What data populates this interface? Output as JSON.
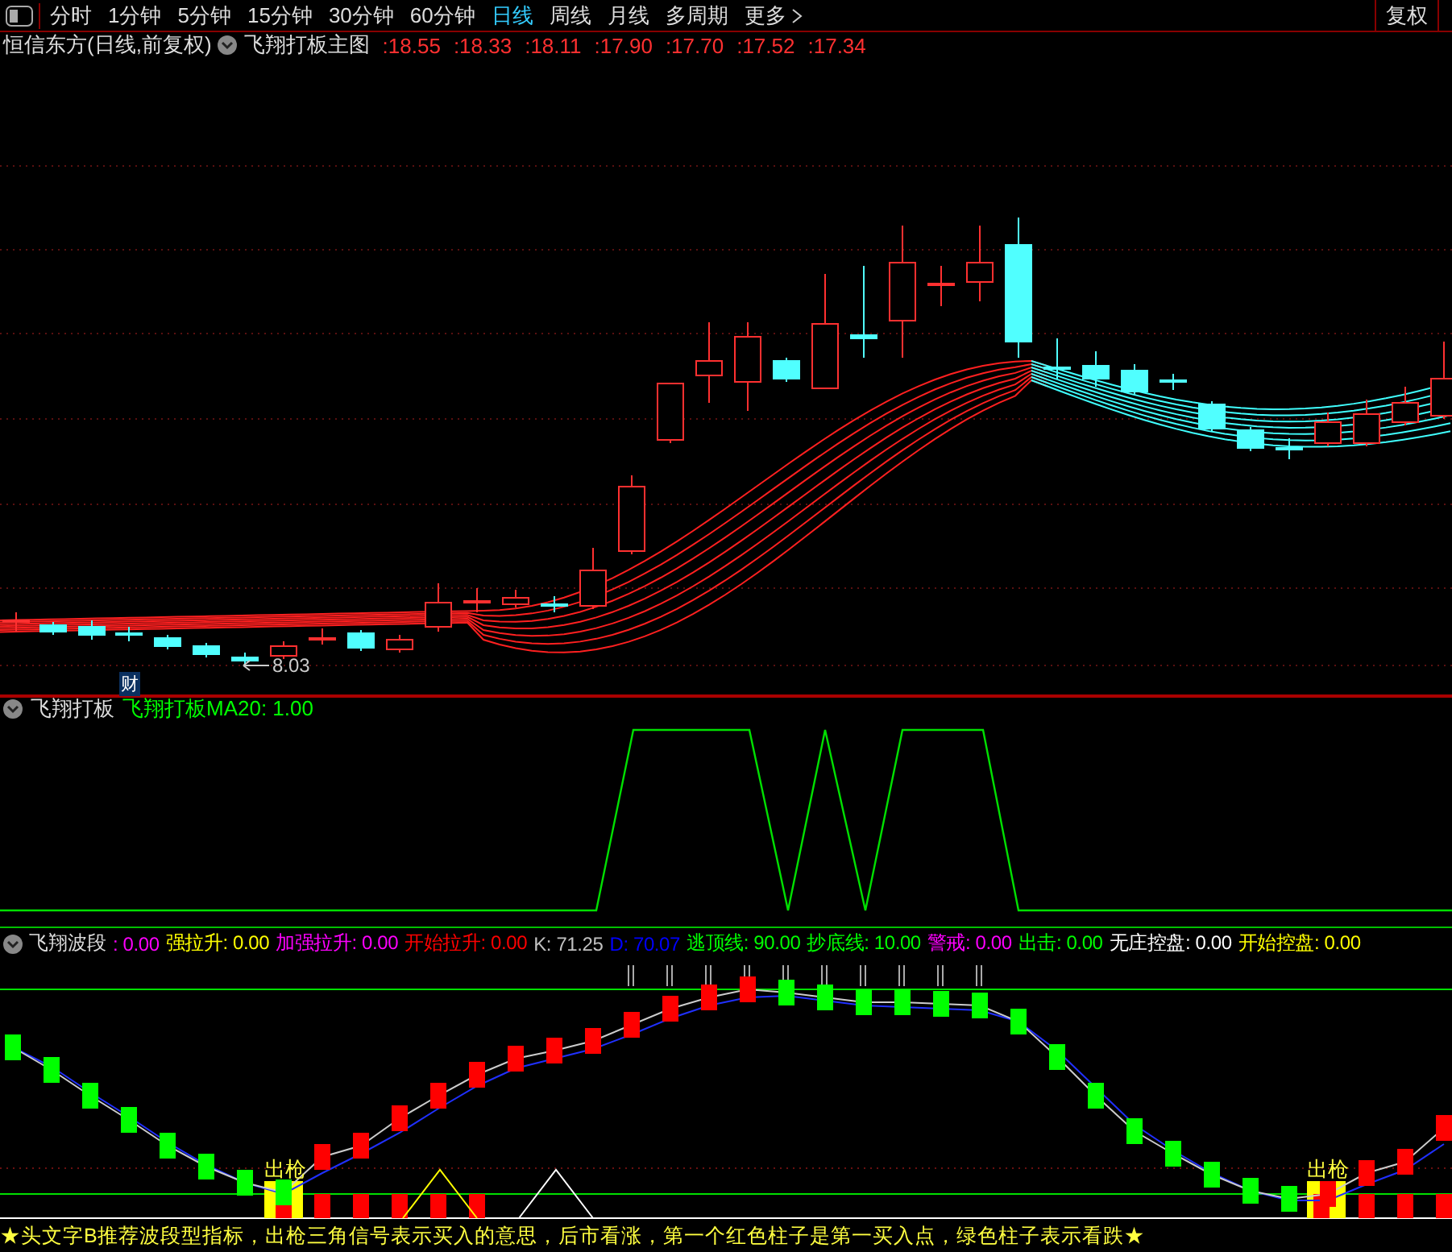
{
  "toolbar": {
    "tabs": [
      {
        "label": "分时",
        "selected": false
      },
      {
        "label": "1分钟",
        "selected": false
      },
      {
        "label": "5分钟",
        "selected": false
      },
      {
        "label": "15分钟",
        "selected": false
      },
      {
        "label": "30分钟",
        "selected": false
      },
      {
        "label": "60分钟",
        "selected": false
      },
      {
        "label": "日线",
        "selected": true
      },
      {
        "label": "周线",
        "selected": false
      },
      {
        "label": "月线",
        "selected": false
      },
      {
        "label": "多周期",
        "selected": false
      }
    ],
    "more": "更多",
    "adjust_button": "复权"
  },
  "main_panel": {
    "title": "恒信东方(日线,前复权)",
    "indicator": "飞翔打板主图",
    "ma_values": [
      ":18.55",
      ":18.33",
      ":18.11",
      ":17.90",
      ":17.70",
      ":17.52",
      ":17.34"
    ],
    "low_label": "8.03",
    "badge": "财"
  },
  "panel_1": {
    "title": "飞翔打板",
    "readings": [
      {
        "label": "飞翔打板MA20: 1.00",
        "color": "#00ff00"
      }
    ]
  },
  "panel_2": {
    "title": "飞翔波段",
    "readings": [
      {
        "label": ": 0.00",
        "color": "#ff00ff"
      },
      {
        "label": "强拉升: 0.00",
        "color": "#ffff00"
      },
      {
        "label": "加强拉升: 0.00",
        "color": "#ff00ff"
      },
      {
        "label": "开始拉升: 0.00",
        "color": "#ff0000"
      },
      {
        "label": "K: 71.25",
        "color": "#c0c0c0"
      },
      {
        "label": "D: 70.07",
        "color": "#0000ff"
      },
      {
        "label": "逃顶线: 90.00",
        "color": "#00ff00"
      },
      {
        "label": "抄底线: 10.00",
        "color": "#00ff00"
      },
      {
        "label": "警戒: 0.00",
        "color": "#ff00ff"
      },
      {
        "label": "出击: 0.00",
        "color": "#00ff00"
      },
      {
        "label": "无庄控盘: 0.00",
        "color": "#ffffff"
      },
      {
        "label": "开始控盘: 0.00",
        "color": "#ffff00"
      }
    ],
    "signals": [
      "出枪",
      "出枪"
    ]
  },
  "footer": "★头文字B推荐波段型指标，出枪三角信号表示买入的意思，后市看涨，第一个红色柱子是第一买入点，绿色柱子表示看跌★"
}
